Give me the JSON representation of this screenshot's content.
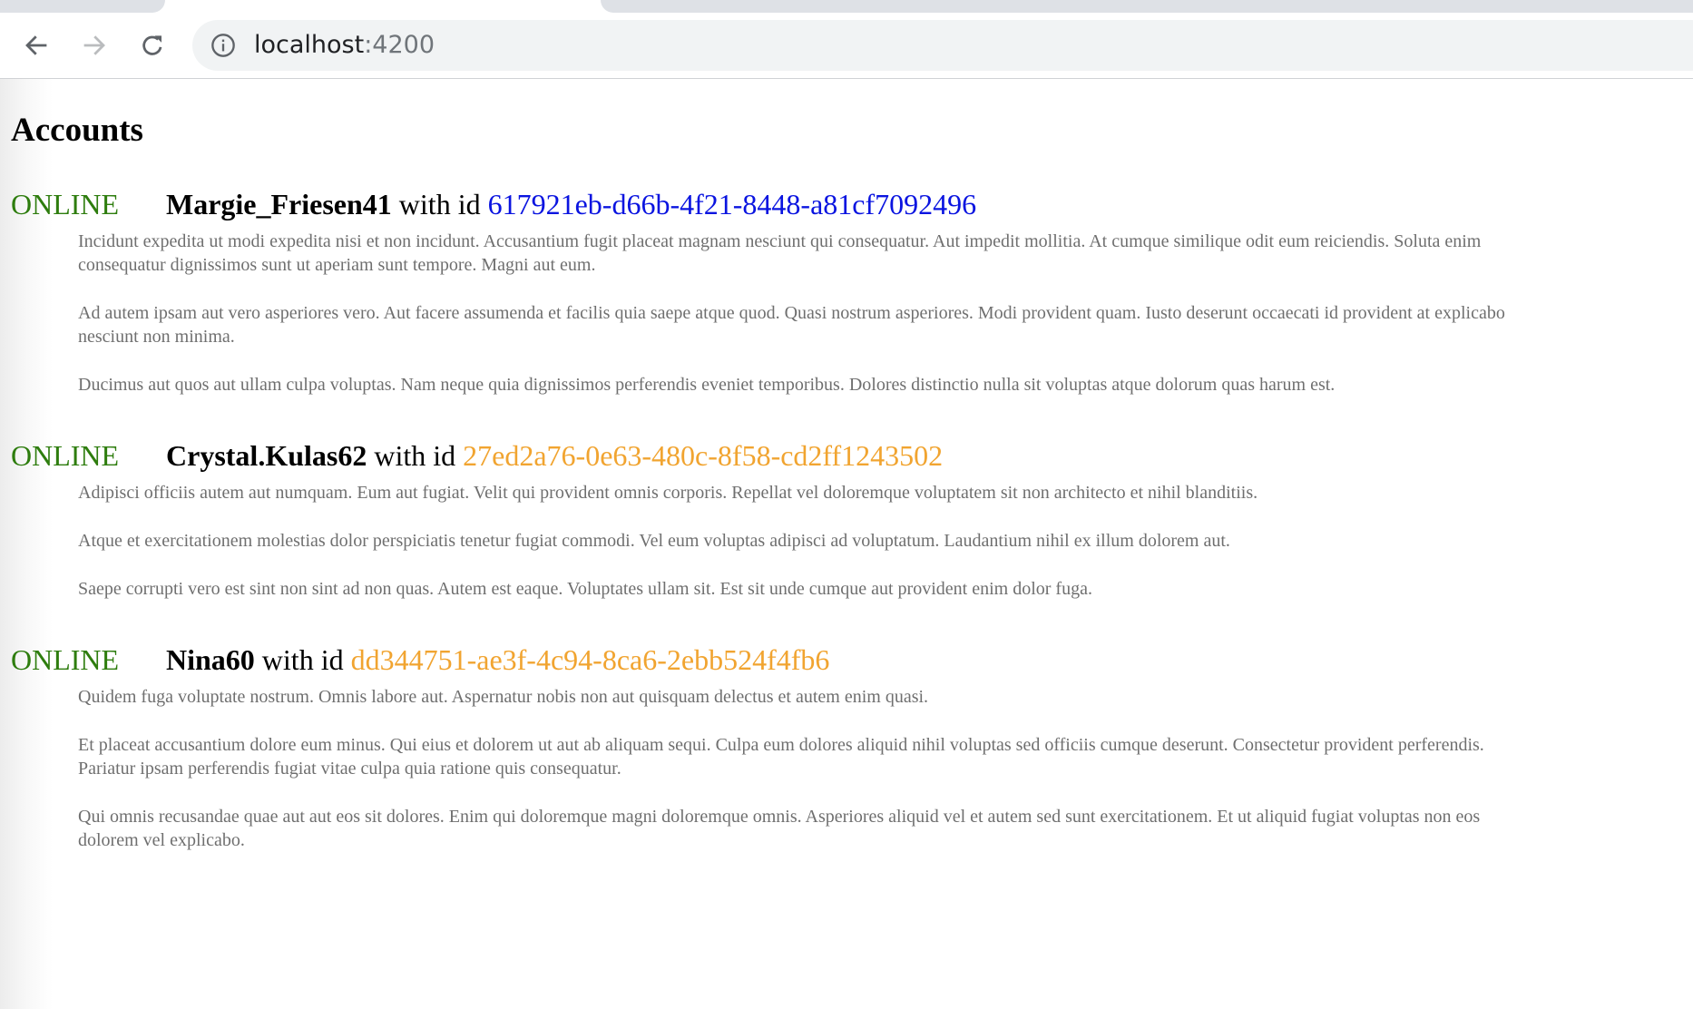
{
  "browser": {
    "url_host": "localhost",
    "url_port": ":4200"
  },
  "page": {
    "title": "Accounts",
    "with_id_text": " with id ",
    "accounts": [
      {
        "status": "ONLINE",
        "username": "Margie_Friesen41",
        "id": "617921eb-d66b-4f21-8448-a81cf7092496",
        "id_color": "#0a14e0",
        "paragraphs": [
          "Incidunt expedita ut modi expedita nisi et non incidunt. Accusantium fugit placeat magnam nesciunt qui consequatur. Aut impedit mollitia. At cumque similique odit eum reiciendis. Soluta enim consequatur dignissimos sunt ut aperiam sunt tempore. Magni aut eum.",
          "Ad autem ipsam aut vero asperiores vero. Aut facere assumenda et facilis quia saepe atque quod. Quasi nostrum asperiores. Modi provident quam. Iusto deserunt occaecati id provident at explicabo nesciunt non minima.",
          "Ducimus aut quos aut ullam culpa voluptas. Nam neque quia dignissimos perferendis eveniet temporibus. Dolores distinctio nulla sit voluptas atque dolorum quas harum est."
        ]
      },
      {
        "status": "ONLINE",
        "username": "Crystal.Kulas62",
        "id": "27ed2a76-0e63-480c-8f58-cd2ff1243502",
        "id_color": "#f1a430",
        "paragraphs": [
          "Adipisci officiis autem aut numquam. Eum aut fugiat. Velit qui provident omnis corporis. Repellat vel doloremque voluptatem sit non architecto et nihil blanditiis.",
          "Atque et exercitationem molestias dolor perspiciatis tenetur fugiat commodi. Vel eum voluptas adipisci ad voluptatum. Laudantium nihil ex illum dolorem aut.",
          "Saepe corrupti vero est sint non sint ad non quas. Autem est eaque. Voluptates ullam sit. Est sit unde cumque aut provident enim dolor fuga."
        ]
      },
      {
        "status": "ONLINE",
        "username": "Nina60",
        "id": "dd344751-ae3f-4c94-8ca6-2ebb524f4fb6",
        "id_color": "#f1a430",
        "paragraphs": [
          "Quidem fuga voluptate nostrum. Omnis labore aut. Aspernatur nobis non aut quisquam delectus et autem enim quasi.",
          "Et placeat accusantium dolore eum minus. Qui eius et dolorem ut aut ab aliquam sequi. Culpa eum dolores aliquid nihil voluptas sed officiis cumque deserunt. Consectetur provident perferendis. Pariatur ipsam perferendis fugiat vitae culpa quia ratione quis consequatur.",
          "Qui omnis recusandae quae aut aut eos sit dolores. Enim qui doloremque magni doloremque omnis. Asperiores aliquid vel et autem sed sunt exercitationem. Et ut aliquid fugiat voluptas non eos dolorem vel explicabo."
        ]
      }
    ]
  },
  "icons": {
    "back": "arrow-left-icon",
    "forward": "arrow-right-icon",
    "reload": "reload-icon",
    "site_info": "info-circle-icon"
  }
}
